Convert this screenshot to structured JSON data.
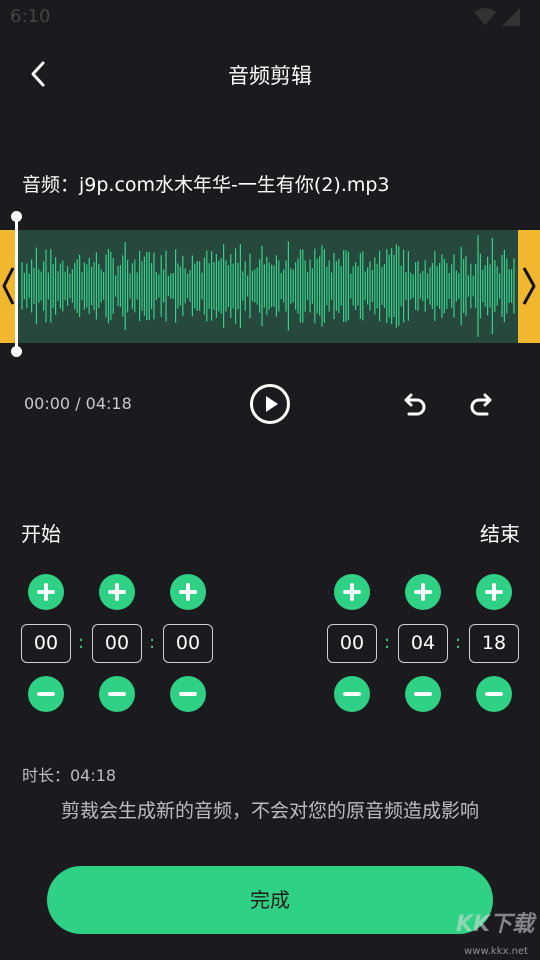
{
  "status_bar": {
    "time": "6:10"
  },
  "header": {
    "title": "音频剪辑"
  },
  "file": {
    "label": "音频：j9p.com水木年华-一生有你(2).mp3"
  },
  "player": {
    "time_readout": "00:00 / 04:18"
  },
  "start": {
    "label": "开始",
    "values": [
      "00",
      "00",
      "00"
    ]
  },
  "end": {
    "label": "结束",
    "values": [
      "00",
      "04",
      "18"
    ]
  },
  "separator": ":",
  "duration": "时长：04:18",
  "hint": "剪裁会生成新的音频，不会对您的原音频造成影响",
  "done_button": {
    "label": "完成"
  },
  "watermark": {
    "text": "KK下载",
    "url": "www.kkx.net"
  },
  "colors": {
    "accent": "#2fd185",
    "handle": "#f0b72f",
    "wave_bg": "#26483d",
    "background": "#1b1a1f"
  }
}
